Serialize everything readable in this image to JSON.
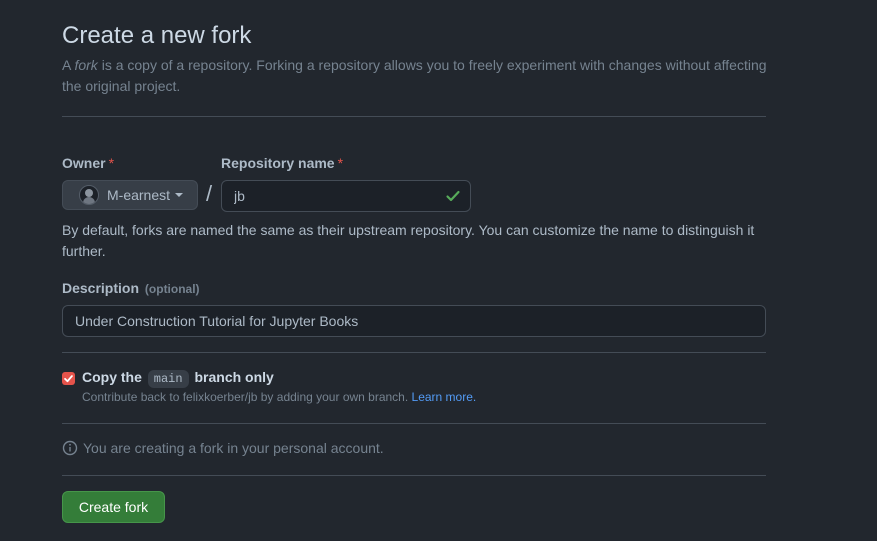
{
  "page": {
    "title": "Create a new fork",
    "subtitle_pre": "A ",
    "subtitle_em": "fork",
    "subtitle_post": " is a copy of a repository. Forking a repository allows you to freely experiment with changes without affecting the original project."
  },
  "owner": {
    "label": "Owner",
    "required_mark": "*",
    "selected": "M-earnest"
  },
  "separator": "/",
  "repo_name": {
    "label": "Repository name",
    "required_mark": "*",
    "value": "jb"
  },
  "naming_hint": "By default, forks are named the same as their upstream repository. You can customize the name to distinguish it further.",
  "description": {
    "label": "Description",
    "optional": "(optional)",
    "value": "Under Construction Tutorial for Jupyter Books"
  },
  "copy_branch": {
    "checked": true,
    "label_pre": "Copy the",
    "branch": "main",
    "label_post": "branch only",
    "note": "Contribute back to felixkoerber/jb by adding your own branch.",
    "link": "Learn more."
  },
  "info": "You are creating a fork in your personal account.",
  "submit_label": "Create fork",
  "colors": {
    "background": "#22272e",
    "accent_green": "#347d39",
    "checkbox": "#e5534b",
    "link": "#539bf5",
    "valid_check": "#57ab5a"
  }
}
